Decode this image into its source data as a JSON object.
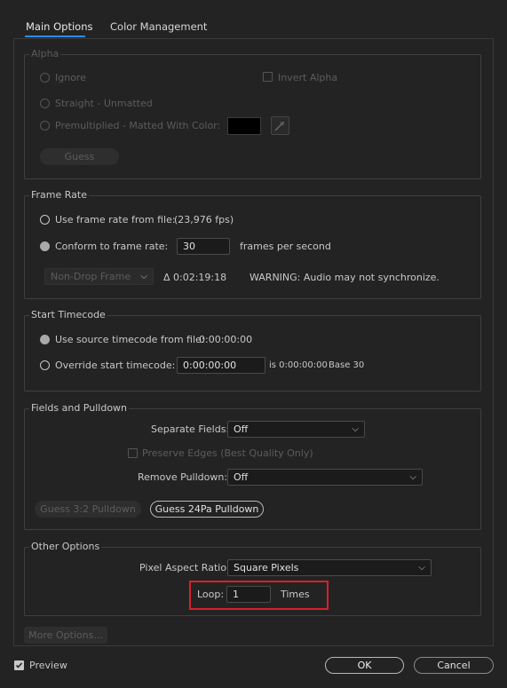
{
  "tabs": {
    "main_options": "Main Options",
    "color_management": "Color Management"
  },
  "alpha": {
    "title": "Alpha",
    "ignore": "Ignore",
    "invert_alpha": "Invert Alpha",
    "straight": "Straight - Unmatted",
    "premultiplied": "Premultiplied - Matted With Color:",
    "guess": "Guess"
  },
  "frame_rate": {
    "title": "Frame Rate",
    "use_from_file": "Use frame rate from file:",
    "file_fps": "(23,976 fps)",
    "conform": "Conform to frame rate:",
    "conform_value": "30",
    "fps_suffix": "frames per second",
    "drop_mode": "Non-Drop Frame",
    "delta": "Δ 0:02:19:18",
    "warning": "WARNING: Audio may not synchronize."
  },
  "start_timecode": {
    "title": "Start Timecode",
    "use_source": "Use source timecode from file:",
    "source_value": "0:00:00:00",
    "override": "Override start timecode:",
    "override_value": "0:00:00:00",
    "is_text": "is 0:00:00:00",
    "base_text": "Base 30"
  },
  "fields": {
    "title": "Fields and Pulldown",
    "separate_label": "Separate Fields:",
    "separate_value": "Off",
    "preserve_edges": "Preserve Edges (Best Quality Only)",
    "remove_label": "Remove Pulldown:",
    "remove_value": "Off",
    "guess32": "Guess 3:2 Pulldown",
    "guess24": "Guess 24Pa Pulldown"
  },
  "other": {
    "title": "Other Options",
    "par_label": "Pixel Aspect Ratio:",
    "par_value": "Square Pixels",
    "loop_label": "Loop:",
    "loop_value": "1",
    "loop_suffix": "Times"
  },
  "more_options": "More Options...",
  "preview": "Preview",
  "ok": "OK",
  "cancel": "Cancel",
  "colors": {
    "background": "#232323",
    "tab_accent": "#2d8ceb",
    "highlight": "#d9202a"
  }
}
